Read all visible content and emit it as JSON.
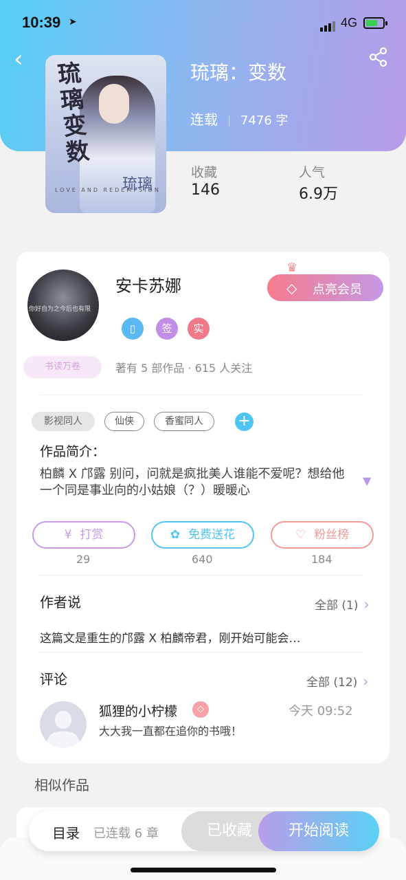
{
  "status_bar": {
    "time": "10:39",
    "network": "4G"
  },
  "book": {
    "title": "琉璃：变数",
    "serial_status": "连载",
    "word_count": "7476 字",
    "cover": {
      "title_text": "琉璃变数",
      "subtitle": "LOVE AND REDEMPSION",
      "stamp": "琉璃"
    },
    "stats": {
      "favorites_label": "收藏",
      "favorites_value": "146",
      "popularity_label": "人气",
      "popularity_value": "6.9万"
    }
  },
  "author": {
    "name": "安卡苏娜",
    "avatar_caption": "你好自为之今后也有限",
    "vip_button": "点亮会员",
    "badges": [
      {
        "icon": "phone-badge-icon",
        "text": "",
        "color": "#5ab8f2"
      },
      {
        "icon": "sign-badge-icon",
        "text": "签",
        "color": "#c38ee6"
      },
      {
        "icon": "real-badge-icon",
        "text": "实",
        "color": "#f07a8a"
      }
    ],
    "reader_badge": "书读万卷",
    "stats_line": "著有 5 部作品 · 615 人关注"
  },
  "tags": [
    "影视同人",
    "仙侠",
    "香蜜同人"
  ],
  "synopsis": {
    "label": "作品简介：",
    "text": "柏麟 X 邝露 别问，问就是疯批美人谁能不爱呢？想给他一个同是事业向的小姑娘（？）暖暖心"
  },
  "actions": [
    {
      "label": "打赏",
      "count": "29",
      "color": "#c59be6"
    },
    {
      "label": "免费送花",
      "count": "640",
      "color": "#4ec5f1"
    },
    {
      "label": "粉丝榜",
      "count": "184",
      "color": "#f09a9a"
    }
  ],
  "author_says": {
    "label": "作者说",
    "all_label": "全部 (1)",
    "text": "这篇文是重生的邝露 X 柏麟帝君，刚开始可能会…"
  },
  "comments": {
    "label": "评论",
    "all_label": "全部 (12)",
    "items": [
      {
        "user": "狐狸的小柠檬",
        "time": "今天 09:52",
        "text": "大大我一直都在追你的书哦！"
      }
    ]
  },
  "similar_label": "相似作品",
  "bottom_bar": {
    "toc_label": "目录",
    "chapters_label": "已连载 6 章",
    "favorited_label": "已收藏",
    "read_label": "开始阅读"
  }
}
